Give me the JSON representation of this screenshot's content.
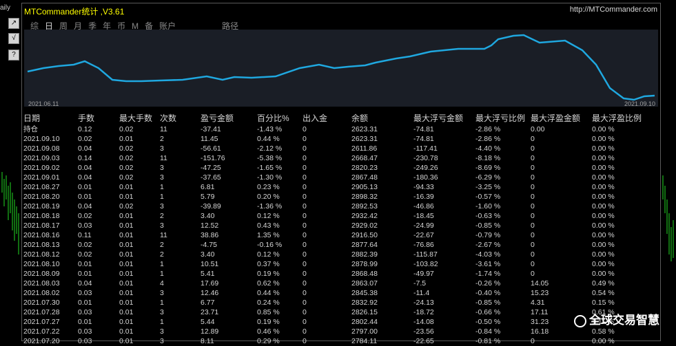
{
  "left_panel": {
    "daily_label": "aily",
    "buttons": [
      "↗",
      "√",
      "?"
    ]
  },
  "window": {
    "title": "MTCommander统计 ,V3.61",
    "url": "http://MTCommander.com"
  },
  "tabs": [
    {
      "label": "综",
      "active": false
    },
    {
      "label": "日",
      "active": true
    },
    {
      "label": "周",
      "active": false
    },
    {
      "label": "月",
      "active": false
    },
    {
      "label": "季",
      "active": false
    },
    {
      "label": "年",
      "active": false
    },
    {
      "label": "币",
      "active": false
    },
    {
      "label": "M",
      "active": false
    },
    {
      "label": "备",
      "active": false
    },
    {
      "label": "账户",
      "active": false
    },
    {
      "label": "路径",
      "active": false
    }
  ],
  "chart": {
    "start_date": "2021.06.11",
    "end_date": "2021.09.10",
    "line_color": "#1fa8e0",
    "background": "#1a1e26"
  },
  "table": {
    "headers": [
      "日期",
      "手数",
      "最大手数",
      "次数",
      "盈亏金额",
      "百分比%",
      "出入金",
      "余额",
      "最大浮亏金额",
      "最大浮亏比例",
      "最大浮盈金额",
      "最大浮盈比例"
    ],
    "rows": [
      {
        "c": [
          "持仓",
          "0.12",
          "0.02",
          "11",
          "-37.41",
          "-1.43 %",
          "0",
          "2623.31",
          "-74.81",
          "-2.86 %",
          "0.00",
          "0.00 %"
        ],
        "t": "g"
      },
      {
        "c": [
          "2021.09.10",
          "0.02",
          "0.01",
          "2",
          "11.45",
          "0.44 %",
          "0",
          "2623.31",
          "-74.81",
          "-2.86 %",
          "0",
          "0.00 %"
        ],
        "t": "r"
      },
      {
        "c": [
          "2021.09.08",
          "0.04",
          "0.02",
          "3",
          "-56.61",
          "-2.12 %",
          "0",
          "2611.86",
          "-117.41",
          "-4.40 %",
          "0",
          "0.00 %"
        ],
        "t": "g"
      },
      {
        "c": [
          "2021.09.03",
          "0.14",
          "0.02",
          "11",
          "-151.76",
          "-5.38 %",
          "0",
          "2668.47",
          "-230.78",
          "-8.18 %",
          "0",
          "0.00 %"
        ],
        "t": "g"
      },
      {
        "c": [
          "2021.09.02",
          "0.04",
          "0.02",
          "3",
          "-47.25",
          "-1.65 %",
          "0",
          "2820.23",
          "-249.26",
          "-8.69 %",
          "0",
          "0.00 %"
        ],
        "t": "g"
      },
      {
        "c": [
          "2021.09.01",
          "0.04",
          "0.02",
          "3",
          "-37.65",
          "-1.30 %",
          "0",
          "2867.48",
          "-180.36",
          "-6.29 %",
          "0",
          "0.00 %"
        ],
        "t": "g"
      },
      {
        "c": [
          "2021.08.27",
          "0.01",
          "0.01",
          "1",
          "6.81",
          "0.23 %",
          "0",
          "2905.13",
          "-94.33",
          "-3.25 %",
          "0",
          "0.00 %"
        ],
        "t": "r"
      },
      {
        "c": [
          "2021.08.20",
          "0.01",
          "0.01",
          "1",
          "5.79",
          "0.20 %",
          "0",
          "2898.32",
          "-16.39",
          "-0.57 %",
          "0",
          "0.00 %"
        ],
        "t": "r"
      },
      {
        "c": [
          "2021.08.19",
          "0.04",
          "0.02",
          "3",
          "-39.89",
          "-1.36 %",
          "0",
          "2892.53",
          "-46.86",
          "-1.60 %",
          "0",
          "0.00 %"
        ],
        "t": "g"
      },
      {
        "c": [
          "2021.08.18",
          "0.02",
          "0.01",
          "2",
          "3.40",
          "0.12 %",
          "0",
          "2932.42",
          "-18.45",
          "-0.63 %",
          "0",
          "0.00 %"
        ],
        "t": "r"
      },
      {
        "c": [
          "2021.08.17",
          "0.03",
          "0.01",
          "3",
          "12.52",
          "0.43 %",
          "0",
          "2929.02",
          "-24.99",
          "-0.85 %",
          "0",
          "0.00 %"
        ],
        "t": "r"
      },
      {
        "c": [
          "2021.08.16",
          "0.11",
          "0.01",
          "11",
          "38.86",
          "1.35 %",
          "0",
          "2916.50",
          "-22.67",
          "-0.79 %",
          "0",
          "0.00 %"
        ],
        "t": "r"
      },
      {
        "c": [
          "2021.08.13",
          "0.02",
          "0.01",
          "2",
          "-4.75",
          "-0.16 %",
          "0",
          "2877.64",
          "-76.86",
          "-2.67 %",
          "0",
          "0.00 %"
        ],
        "t": "g"
      },
      {
        "c": [
          "2021.08.12",
          "0.02",
          "0.01",
          "2",
          "3.40",
          "0.12 %",
          "0",
          "2882.39",
          "-115.87",
          "-4.03 %",
          "0",
          "0.00 %"
        ],
        "t": "r"
      },
      {
        "c": [
          "2021.08.10",
          "0.01",
          "0.01",
          "1",
          "10.51",
          "0.37 %",
          "0",
          "2878.99",
          "-103.82",
          "-3.61 %",
          "0",
          "0.00 %"
        ],
        "t": "r"
      },
      {
        "c": [
          "2021.08.09",
          "0.01",
          "0.01",
          "1",
          "5.41",
          "0.19 %",
          "0",
          "2868.48",
          "-49.97",
          "-1.74 %",
          "0",
          "0.00 %"
        ],
        "t": "r"
      },
      {
        "c": [
          "2021.08.03",
          "0.04",
          "0.01",
          "4",
          "17.69",
          "0.62 %",
          "0",
          "2863.07",
          "-7.5",
          "-0.26 %",
          "14.05",
          "0.49 %"
        ],
        "t": "r",
        "p": true
      },
      {
        "c": [
          "2021.08.02",
          "0.03",
          "0.01",
          "3",
          "12.46",
          "0.44 %",
          "0",
          "2845.38",
          "-11.4",
          "-0.40 %",
          "15.23",
          "0.54 %"
        ],
        "t": "r",
        "p": true
      },
      {
        "c": [
          "2021.07.30",
          "0.01",
          "0.01",
          "1",
          "6.77",
          "0.24 %",
          "0",
          "2832.92",
          "-24.13",
          "-0.85 %",
          "4.31",
          "0.15 %"
        ],
        "t": "r",
        "p": true
      },
      {
        "c": [
          "2021.07.28",
          "0.03",
          "0.01",
          "3",
          "23.71",
          "0.85 %",
          "0",
          "2826.15",
          "-18.72",
          "-0.66 %",
          "17.11",
          "0.61 %"
        ],
        "t": "r",
        "p": true
      },
      {
        "c": [
          "2021.07.27",
          "0.01",
          "0.01",
          "1",
          "5.44",
          "0.19 %",
          "0",
          "2802.44",
          "-14.08",
          "-0.50 %",
          "31.23",
          "1.11 %"
        ],
        "t": "r",
        "p": true
      },
      {
        "c": [
          "2021.07.22",
          "0.03",
          "0.01",
          "3",
          "12.89",
          "0.46 %",
          "0",
          "2797.00",
          "-23.56",
          "-0.84 %",
          "16.18",
          "0.58 %"
        ],
        "t": "r",
        "p": true
      },
      {
        "c": [
          "2021.07.20",
          "0.03",
          "0.01",
          "3",
          "8.11",
          "0.29 %",
          "0",
          "2784.11",
          "-22.65",
          "-0.81 %",
          "0",
          "0.00 %"
        ],
        "t": "r"
      }
    ]
  },
  "watermark": "全球交易智慧",
  "colors": {
    "profit": "#ee2222",
    "loss": "#33ee33",
    "text": "#d6d6d6",
    "title": "#ffff00"
  }
}
